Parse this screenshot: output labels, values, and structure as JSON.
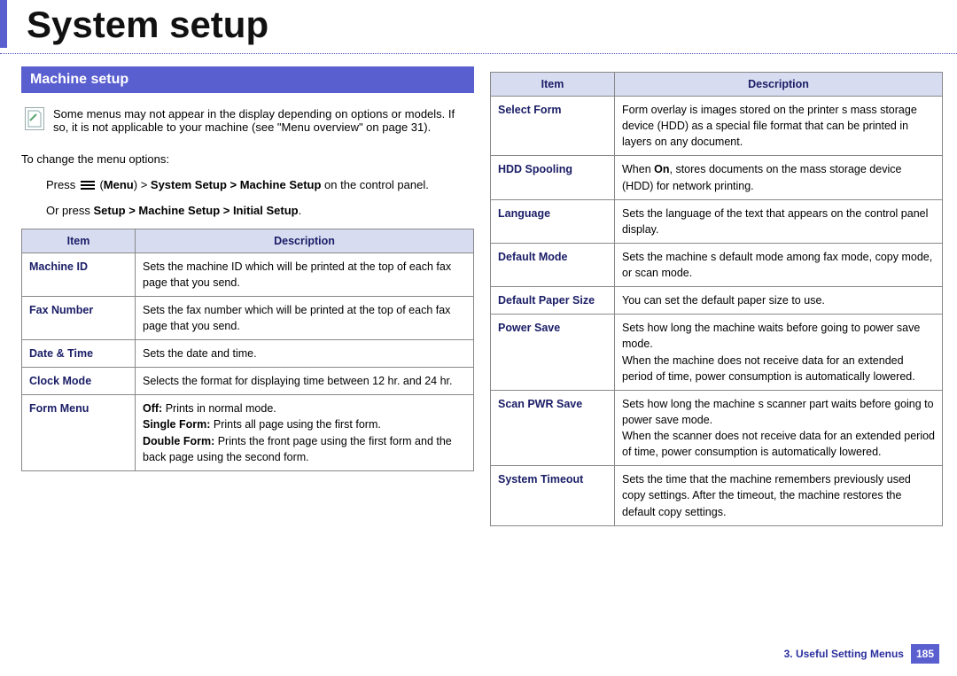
{
  "page_title": "System setup",
  "section_heading": "Machine setup",
  "note_text": "Some menus may not appear in the display depending on options or models. If so, it is not applicable to your machine (see \"Menu overview\" on page 31).",
  "intro_line": "To change the menu options:",
  "press_prefix": "Press ",
  "press_menu_bold": "Menu",
  "press_gt": ") > ",
  "press_path_bold": "System Setup > Machine Setup",
  "press_suffix": " on the control panel.",
  "or_press_prefix": "Or press ",
  "or_press_bold": "Setup > Machine Setup > Initial Setup",
  "or_press_suffix": ".",
  "table_headers": {
    "item": "Item",
    "description": "Description"
  },
  "left_rows": [
    {
      "item": "Machine ID",
      "desc": "Sets the machine ID which will be printed at the top of each fax page that you send."
    },
    {
      "item": "Fax Number",
      "desc": "Sets the fax number which will be printed at the top of each fax page that you send."
    },
    {
      "item": "Date & Time",
      "desc": "Sets the date and time."
    },
    {
      "item": "Clock Mode",
      "desc": "Selects the format for displaying time between 12 hr. and 24 hr."
    }
  ],
  "form_menu": {
    "item": "Form Menu",
    "off_label": "Off:",
    "off_text": " Prints in normal mode.",
    "single_label": "Single Form:",
    "single_text": " Prints all page using the first form.",
    "double_label": "Double Form:",
    "double_text": " Prints the front page using the first form and the back page using the second form."
  },
  "right_rows_a": [
    {
      "item": "Select Form",
      "desc": "Form overlay is images stored on the printer s mass storage device (HDD) as a special file format that can be printed in layers on any document."
    }
  ],
  "hdd_row": {
    "item": "HDD Spooling",
    "prefix": "When ",
    "on": "On",
    "suffix": ", stores documents on the mass storage device (HDD) for network printing."
  },
  "right_rows_b": [
    {
      "item": "Language",
      "desc": "Sets the language of the text that appears on the control panel display."
    },
    {
      "item": "Default Mode",
      "desc": "Sets the machine s default mode among fax mode, copy mode, or scan mode."
    },
    {
      "item": "Default Paper Size",
      "desc": "You can set the default paper size to use."
    }
  ],
  "power_save": {
    "item": "Power Save",
    "p1": "Sets how long the machine waits before going to power save mode.",
    "p2": "When the machine does not receive data for an extended period of time, power consumption is automatically lowered."
  },
  "scan_pwr": {
    "item": "Scan PWR Save",
    "p1": "Sets how long the machine s scanner part waits before going to power save mode.",
    "p2": "When the scanner does not receive data for an extended period of time, power consumption is automatically lowered."
  },
  "system_timeout": {
    "item": "System Timeout",
    "desc": "Sets the time that the machine remembers previously used copy settings. After the timeout, the machine restores the default copy settings."
  },
  "footer_chapter": "3.  Useful Setting Menus",
  "footer_page": "185"
}
